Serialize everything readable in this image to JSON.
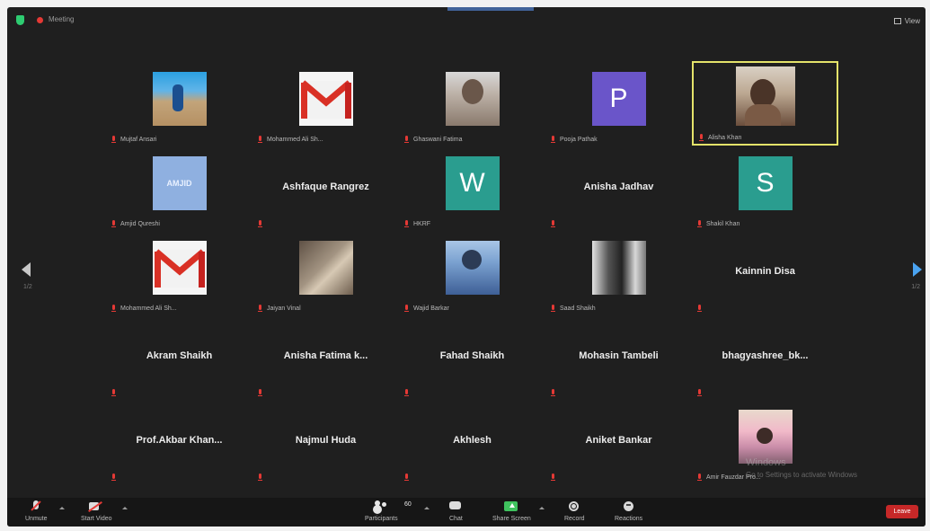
{
  "topbar": {
    "meeting_info_label": "Meeting",
    "view_label": "View"
  },
  "colors": {
    "window_bg": "#1f1f1f",
    "active_speaker_border": "#e4e36a",
    "leave_red": "#c62828",
    "share_green": "#3fc25e",
    "next_arrow_blue": "#4aa3f0"
  },
  "pagination": {
    "prev_icon": "chevron-left-icon",
    "next_icon": "chevron-right-icon",
    "left_label": "1/2",
    "right_label": "1/2"
  },
  "participants": [
    {
      "avatar": "photo-soccer",
      "name_label": "Mujtaf Ansari"
    },
    {
      "avatar": "gmail",
      "name_label": "Mohammed Ali Sh..."
    },
    {
      "avatar": "photo-man1",
      "name_label": "Ghaswani Fatima"
    },
    {
      "avatar": "letter",
      "letter": "P",
      "color": "#6a55c9",
      "name_label": "Pooja Pathak"
    },
    {
      "avatar": "photo-main",
      "name_label": "Alisha Khan",
      "active": true
    },
    {
      "avatar": "photo-amjid",
      "avatar_text": "AMJID",
      "name_label": "Amjid Qureshi"
    },
    {
      "avatar": "none",
      "display_name": "Ashfaque Rangrez",
      "name_label": ""
    },
    {
      "avatar": "letter",
      "letter": "W",
      "color": "#2a9d8f",
      "name_label": "HKRF"
    },
    {
      "avatar": "none",
      "display_name": "Anisha Jadhav",
      "name_label": ""
    },
    {
      "avatar": "letter",
      "letter": "S",
      "color": "#2a9d8f",
      "name_label": "Shakil Khan"
    },
    {
      "avatar": "gmail",
      "name_label": "Mohammed Ali Sh..."
    },
    {
      "avatar": "photo-group",
      "name_label": "Jaiyan Vinal"
    },
    {
      "avatar": "photo-blue",
      "name_label": "Wajid Barkar"
    },
    {
      "avatar": "photo-bw",
      "name_label": "Saad Shaikh"
    },
    {
      "avatar": "none",
      "display_name": "Kainnin Disa",
      "name_label": ""
    },
    {
      "avatar": "none",
      "display_name": "Akram Shaikh",
      "name_label": ""
    },
    {
      "avatar": "none",
      "display_name": "Anisha Fatima k...",
      "name_label": ""
    },
    {
      "avatar": "none",
      "display_name": "Fahad Shaikh",
      "name_label": ""
    },
    {
      "avatar": "none",
      "display_name": "Mohasin Tambeli",
      "name_label": ""
    },
    {
      "avatar": "none",
      "display_name": "bhagyashree_bk...",
      "name_label": ""
    },
    {
      "avatar": "none",
      "display_name": "Prof.Akbar  Khan...",
      "name_label": ""
    },
    {
      "avatar": "none",
      "display_name": "Najmul Huda",
      "name_label": ""
    },
    {
      "avatar": "none",
      "display_name": "Akhlesh",
      "name_label": ""
    },
    {
      "avatar": "none",
      "display_name": "Aniket Bankar",
      "name_label": ""
    },
    {
      "avatar": "photo-family",
      "name_label": "Amir Fauzdar Pro..."
    }
  ],
  "watermark": {
    "title": "Windows",
    "subtitle": "Go to Settings to activate Windows"
  },
  "toolbar": {
    "unmute_label": "Unmute",
    "start_video_label": "Start Video",
    "participants_label": "Participants",
    "participants_count": "60",
    "chat_label": "Chat",
    "share_screen_label": "Share Screen",
    "record_label": "Record",
    "reactions_label": "Reactions",
    "leave_label": "Leave"
  }
}
